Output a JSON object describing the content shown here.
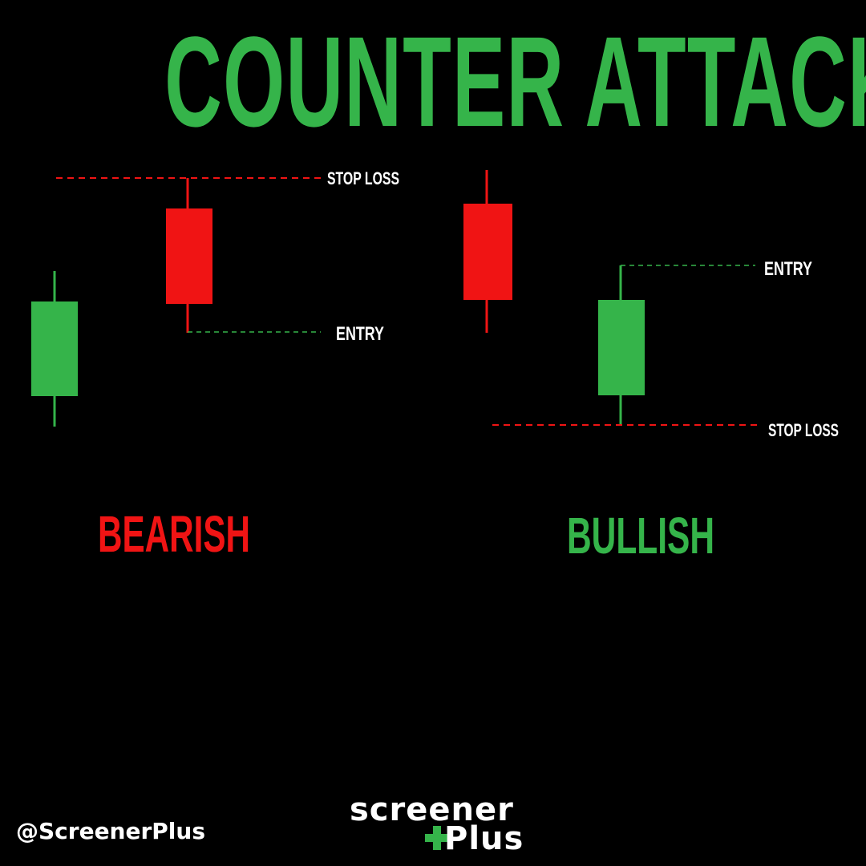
{
  "title": "COUNTER ATTACK",
  "colors": {
    "background": "#000000",
    "bull": "#35b44a",
    "bear": "#f01414",
    "text": "#ffffff"
  },
  "labels": {
    "stop_loss": "STOP LOSS",
    "entry": "ENTRY"
  },
  "bearish": {
    "label": "BEARISH"
  },
  "bullish": {
    "label": "BULLISH"
  },
  "footer": {
    "handle": "@ScreenerPlus",
    "logo_line1": "screener",
    "logo_line2": "Plus"
  }
}
